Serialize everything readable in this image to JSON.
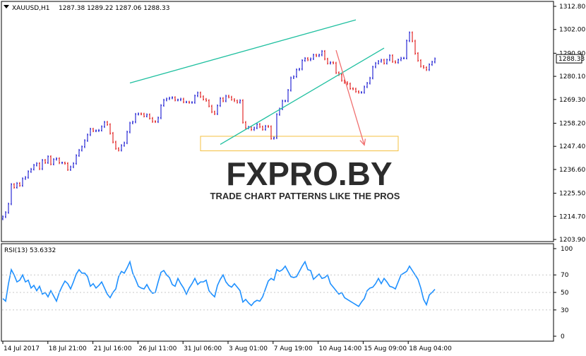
{
  "colors": {
    "bull": "#0000cc",
    "bear": "#dd0000",
    "channel": "#20c0a0",
    "arrow": "#f07070",
    "target_box": "#f5c040",
    "rsi": "#1e90ff",
    "logo": "#2c2c2c"
  },
  "watermark": {
    "brand": "FXPRO.BY",
    "tagline": "TRADE CHART PATTERNS LIKE THE PROS"
  },
  "chart_data": [
    {
      "type": "line",
      "symbol_label": "XAUUSD,H1",
      "ohlc_readout": "1287.38 1289.22 1287.06 1288.33",
      "current_price_label": "1288.33",
      "current_price": 1288.33,
      "ylim": [
        1203.9,
        1312.8
      ],
      "y_ticks": [
        "1312.80",
        "1302.00",
        "1290.90",
        "1280.10",
        "1269.30",
        "1258.20",
        "1247.40",
        "1236.60",
        "1225.50",
        "1214.70",
        "1203.90"
      ],
      "x_ticks": [
        "14 Jul 2017",
        "18 Jul 21:00",
        "21 Jul 16:00",
        "26 Jul 11:00",
        "31 Jul 06:00",
        "3 Aug 01:00",
        "7 Aug 19:00",
        "10 Aug 14:00",
        "15 Aug 09:00",
        "18 Aug 04:00"
      ],
      "x": [
        0,
        2,
        4,
        6,
        8,
        10,
        12,
        14,
        16,
        18,
        20,
        22,
        24,
        26,
        28,
        30,
        32,
        34,
        36,
        38,
        40,
        42,
        44,
        46,
        48,
        50,
        52,
        54,
        56,
        58,
        60,
        62,
        64,
        66,
        68,
        70,
        72,
        74,
        76,
        78,
        80,
        82,
        84,
        86,
        88,
        90,
        92,
        94,
        96,
        98,
        100,
        102,
        104,
        106,
        108,
        110,
        112,
        114,
        116,
        118,
        120,
        122,
        124,
        126,
        128,
        130,
        132,
        134,
        136,
        138,
        140,
        142,
        144,
        146,
        148,
        150,
        152,
        154,
        156,
        158,
        160,
        162,
        164,
        166,
        168,
        170,
        172,
        174,
        176,
        178,
        180,
        182,
        184,
        186,
        188,
        190,
        192,
        194,
        196,
        198,
        200,
        202,
        204,
        206,
        208,
        210,
        212,
        214,
        216,
        218,
        220,
        222,
        224,
        226,
        228,
        230,
        232,
        234,
        236,
        238,
        240,
        242,
        244,
        246,
        248,
        250,
        252,
        254,
        256,
        258,
        260,
        262,
        264,
        266,
        268,
        270,
        272,
        274,
        276,
        278,
        280,
        282,
        284,
        286,
        288,
        290,
        292,
        294,
        296,
        298,
        300,
        302,
        304,
        306
      ],
      "series": [
        {
          "values": [
            1214.5,
            1216.5,
            1220.5,
            1229.6,
            1228.2,
            1230.1,
            1229.1,
            1232.3,
            1232.9,
            1235.6,
            1236.7,
            1238.6,
            1239.4,
            1236.9,
            1240.9,
            1239.8,
            1242.6,
            1239.1,
            1241.3,
            1241.7,
            1239.7,
            1239.7,
            1239.4,
            1236.5,
            1237.8,
            1239.4,
            1243.1,
            1245.6,
            1247.2,
            1250.1,
            1252.8,
            1255.5,
            1254.6,
            1254.7,
            1254.9,
            1256.6,
            1258.7,
            1257.6,
            1253.5,
            1249.4,
            1246.4,
            1245.6,
            1247.8,
            1249.0,
            1254.1,
            1258.3,
            1258.8,
            1262.4,
            1262.6,
            1262.5,
            1261.5,
            1262.2,
            1260.5,
            1259.0,
            1258.9,
            1260.7,
            1266.5,
            1269.0,
            1269.6,
            1270.0,
            1270.2,
            1269.0,
            1269.1,
            1269.5,
            1268.1,
            1268.1,
            1267.9,
            1267.9,
            1271.0,
            1272.4,
            1270.6,
            1269.4,
            1268.8,
            1266.2,
            1263.5,
            1262.6,
            1266.4,
            1269.8,
            1268.6,
            1270.9,
            1270.4,
            1269.3,
            1268.7,
            1268.0,
            1268.8,
            1258.6,
            1256.0,
            1256.4,
            1255.2,
            1256.0,
            1257.7,
            1256.5,
            1255.3,
            1256.8,
            1256.6,
            1251.1,
            1251.4,
            1262.3,
            1264.9,
            1268.6,
            1268.6,
            1273.6,
            1279.4,
            1280.0,
            1283.2,
            1283.5,
            1287.5,
            1288.5,
            1287.8,
            1288.3,
            1290.1,
            1289.7,
            1290.1,
            1291.8,
            1288.2,
            1286.2,
            1286.6,
            1286.3,
            1281.8,
            1280.9,
            1278.2,
            1277.2,
            1276.6,
            1274.4,
            1274.2,
            1273.0,
            1272.6,
            1272.6,
            1275.2,
            1276.9,
            1279.3,
            1284.5,
            1286.2,
            1287.1,
            1287.7,
            1286.2,
            1287.8,
            1289.8,
            1287.0,
            1286.6,
            1287.8,
            1288.6,
            1288.6,
            1296.7,
            1300.5,
            1296.6,
            1290.8,
            1287.5,
            1284.8,
            1284.2,
            1283.2,
            1285.6,
            1286.8,
            1288.3
          ]
        },
        {
          "name": "RSI(13) 53.6332",
          "values": [
            43,
            40,
            60,
            76,
            70,
            62,
            64,
            70,
            62,
            64,
            55,
            58,
            52,
            57,
            48,
            50,
            45,
            52,
            46,
            40,
            50,
            57,
            63,
            60,
            54,
            62,
            71,
            76,
            72,
            72,
            68,
            57,
            60,
            55,
            58,
            62,
            55,
            48,
            44,
            50,
            54,
            68,
            74,
            72,
            78,
            85,
            72,
            65,
            57,
            55,
            54,
            59,
            53,
            49,
            50,
            62,
            73,
            75,
            70,
            67,
            59,
            57,
            66,
            60,
            55,
            48,
            55,
            60,
            66,
            59,
            62,
            62,
            64,
            52,
            48,
            45,
            58,
            65,
            70,
            62,
            58,
            56,
            60,
            56,
            52,
            39,
            42,
            38,
            35,
            39,
            41,
            40,
            45,
            54,
            63,
            66,
            64,
            76,
            74,
            76,
            80,
            74,
            68,
            67,
            68,
            74,
            80,
            85,
            76,
            75,
            65,
            68,
            71,
            66,
            67,
            70,
            60,
            56,
            52,
            48,
            50,
            44,
            42,
            40,
            38,
            36,
            34,
            39,
            43,
            52,
            55,
            56,
            60,
            66,
            60,
            66,
            62,
            57,
            56,
            54,
            62,
            70,
            72,
            74,
            80,
            75,
            70,
            65,
            55,
            42,
            36,
            47,
            50,
            53.6
          ]
        }
      ],
      "annotations": {
        "upper_channel": {
          "from": [
            90,
            1277.0
          ],
          "to": [
            250,
            1306.5
          ]
        },
        "lower_channel": {
          "from": [
            154,
            1248.3
          ],
          "to": [
            270,
            1293.3
          ]
        },
        "arrow": {
          "from": [
            236,
            1292.3
          ],
          "to": [
            256,
            1248.0
          ]
        },
        "target_zone": {
          "x_start": 140,
          "x_end": 280,
          "y_low": 1245.3,
          "y_high": 1252.1
        }
      }
    },
    {
      "type": "line",
      "title": "RSI(13) 53.6332",
      "ylim": [
        0,
        100
      ],
      "y_ticks": [
        "100",
        "70",
        "50",
        "30",
        "0"
      ]
    }
  ]
}
